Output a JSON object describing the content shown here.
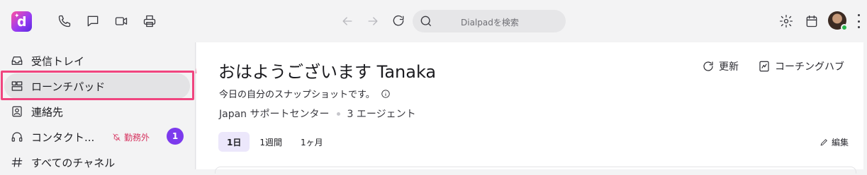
{
  "topbar": {
    "search_placeholder": "Dialpadを検索",
    "icons": [
      "phone-icon",
      "chat-icon",
      "video-icon",
      "printer-icon",
      "back-arrow-icon",
      "forward-arrow-icon",
      "refresh-icon",
      "search-icon",
      "settings-icon",
      "calendar-icon"
    ]
  },
  "sidebar": {
    "items": [
      {
        "label": "受信トレイ",
        "icon": "inbox-icon"
      },
      {
        "label": "ローンチパッド",
        "icon": "launchpad-icon",
        "active": true
      },
      {
        "label": "連絡先",
        "icon": "contacts-icon"
      },
      {
        "label": "コンタクト...",
        "icon": "headset-icon",
        "status": "勤務外",
        "badge": "1"
      },
      {
        "label": "すべてのチャネル",
        "icon": "hash-icon"
      }
    ],
    "highlight_color": "#f0457f"
  },
  "main": {
    "greeting": "おはようございます Tanaka",
    "subtitle": "今日の自分のスナップショットです。",
    "team_name": "Japan サポートセンター",
    "agents": "3 エージェント",
    "refresh_label": "更新",
    "coaching_label": "コーチングハブ",
    "tabs": [
      {
        "label": "1日",
        "active": true
      },
      {
        "label": "1週間"
      },
      {
        "label": "1ヶ月"
      }
    ],
    "edit_label": "編集"
  },
  "colors": {
    "accent_purple": "#7c3aed",
    "status_red": "#d6335f",
    "online_green": "#27b44a"
  }
}
